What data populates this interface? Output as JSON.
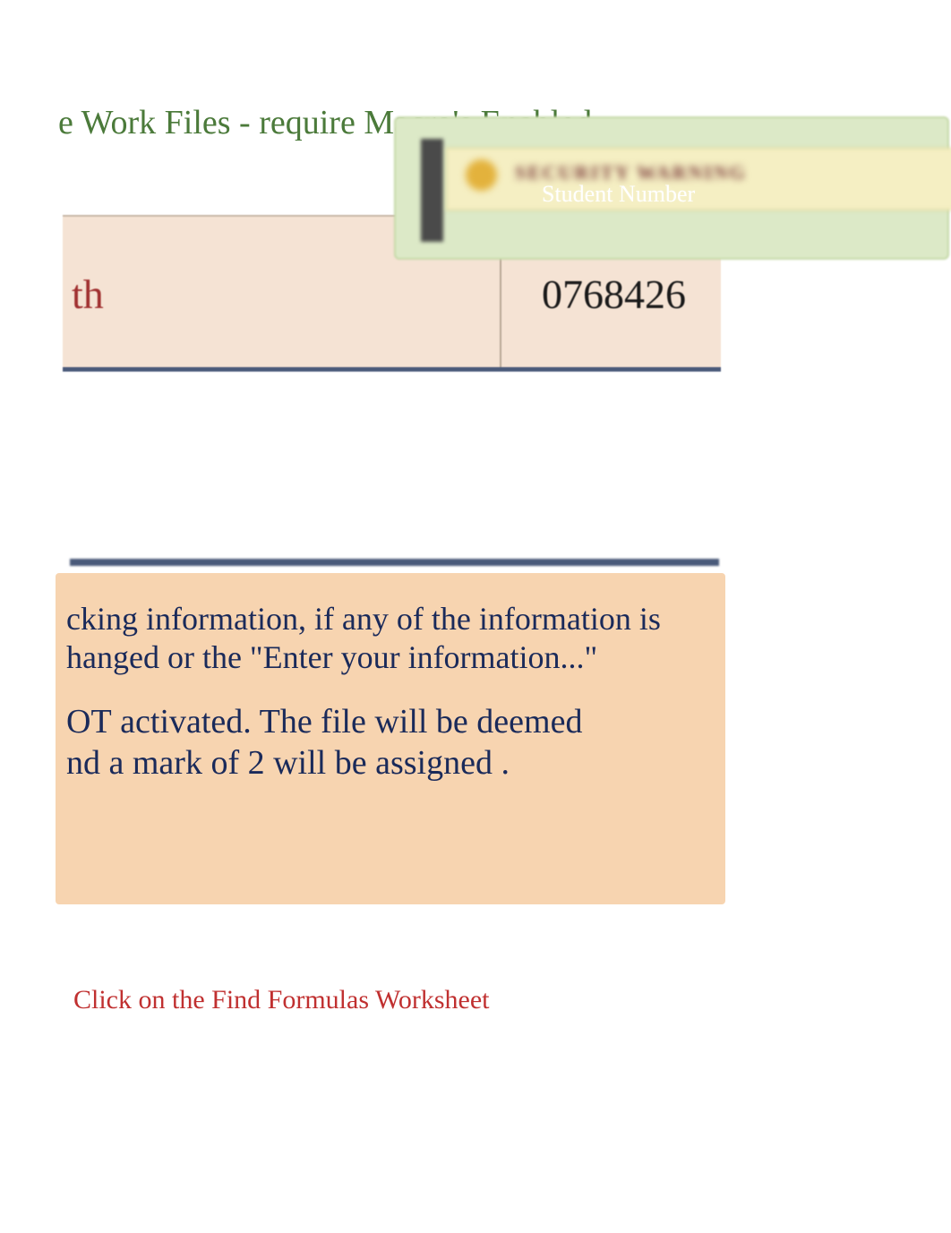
{
  "heading": "e Work Files - require Macro's Enabled",
  "security_warning_blur": "SECURITY WARNING",
  "student_number_label": "Student Number",
  "student_row": {
    "left_fragment": "th",
    "number": "0768426"
  },
  "info": {
    "para1": "cking information, if any of the information is hanged or the \"Enter your information...\"",
    "para2_left": "OT",
    "para2_mid": "activated.    The file will be deemed",
    "para2_bottom": "nd a mark of 2 will be assigned ."
  },
  "footer_instruction": "Click on the Find Formulas Worksheet"
}
